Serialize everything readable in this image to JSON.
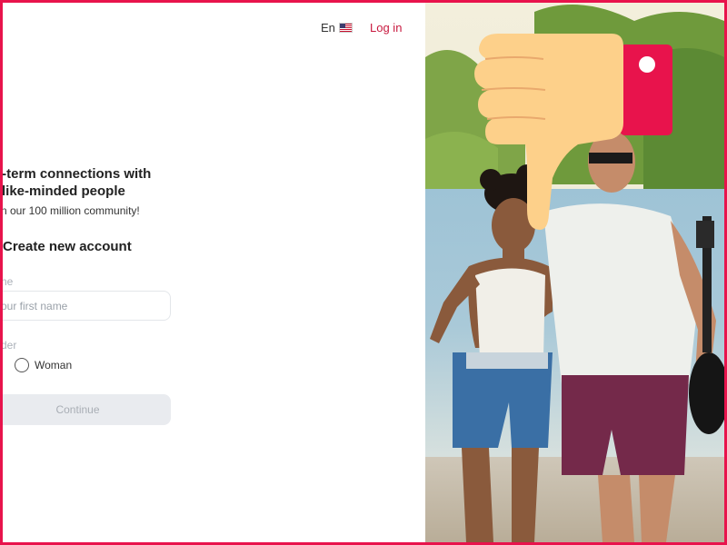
{
  "header": {
    "language_label": "En",
    "language_flag": "us-flag-icon",
    "login_label": "Log in"
  },
  "hero": {
    "headline_line1": "g-term connections with",
    "headline_line2": "like-minded people",
    "subline": "n our 100 million community!"
  },
  "form": {
    "title": "Create new account",
    "name_label": "ne",
    "name_placeholder": "our first name",
    "gender_label": "der",
    "gender_option_visible": "Woman",
    "continue_label": "Continue"
  },
  "overlay": {
    "icon": "thumbs-down-icon"
  },
  "colors": {
    "accent": "#e8134c",
    "login_link": "#c8193f",
    "button_disabled_bg": "#e9ebef",
    "thumb_skin": "#fdd08a",
    "thumb_cuff": "#e8134c"
  }
}
